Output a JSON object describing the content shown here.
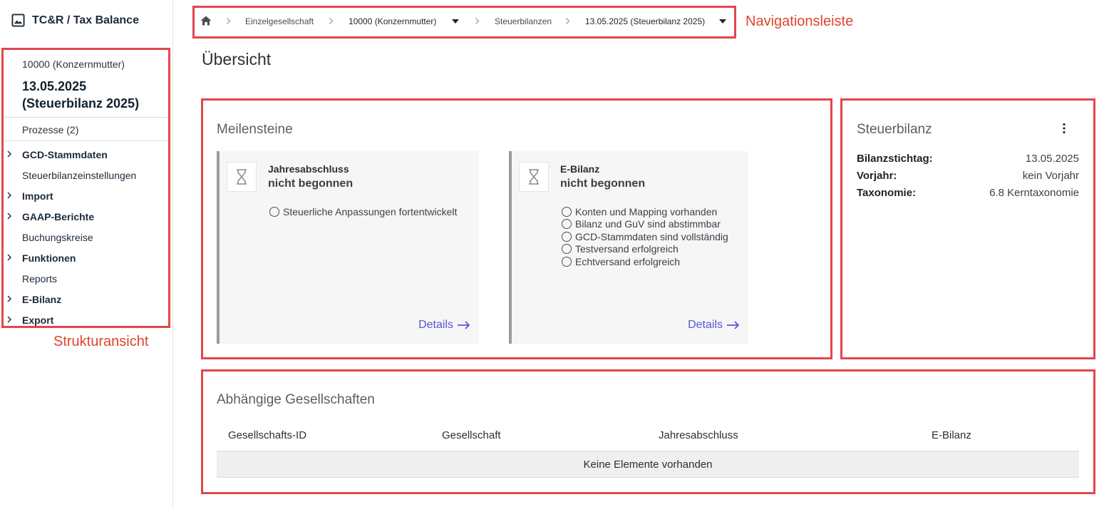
{
  "app": {
    "title": "TC&R / Tax Balance"
  },
  "sidebar": {
    "company": "10000 (Konzernmutter)",
    "date_title_line1": "13.05.2025",
    "date_title_line2": "(Steuerbilanz 2025)",
    "processes": "Prozesse (2)",
    "items": [
      {
        "label": "GCD-Stammdaten",
        "expandable": true
      },
      {
        "label": "Steuerbilanzeinstellungen",
        "expandable": false
      },
      {
        "label": "Import",
        "expandable": true
      },
      {
        "label": "GAAP-Berichte",
        "expandable": true
      },
      {
        "label": "Buchungskreise",
        "expandable": false
      },
      {
        "label": "Funktionen",
        "expandable": true
      },
      {
        "label": "Reports",
        "expandable": false
      },
      {
        "label": "E-Bilanz",
        "expandable": true
      },
      {
        "label": "Export",
        "expandable": true
      }
    ],
    "annotation": "Strukturansicht"
  },
  "breadcrumb": {
    "items": [
      "Einzelgesellschaft",
      "10000 (Konzernmutter)",
      "Steuerbilanzen",
      "13.05.2025 (Steuerbilanz 2025)"
    ],
    "annotation": "Navigationsleiste"
  },
  "page": {
    "title": "Übersicht"
  },
  "milestones": {
    "title": "Meilensteine",
    "cards": [
      {
        "name": "Jahresabschluss",
        "status": "nicht begonnen",
        "checks": [
          "Steuerliche Anpassungen fortentwickelt"
        ],
        "details": "Details"
      },
      {
        "name": "E-Bilanz",
        "status": "nicht begonnen",
        "checks": [
          "Konten und Mapping vorhanden",
          "Bilanz und GuV sind abstimmbar",
          "GCD-Stammdaten sind vollständig",
          "Testversand erfolgreich",
          "Echtversand erfolgreich"
        ],
        "details": "Details"
      }
    ]
  },
  "taxbalance": {
    "title": "Steuerbilanz",
    "rows": [
      {
        "key": "Bilanzstichtag:",
        "value": "13.05.2025"
      },
      {
        "key": "Vorjahr:",
        "value": "kein Vorjahr"
      },
      {
        "key": "Taxonomie:",
        "value": "6.8 Kerntaxonomie"
      }
    ]
  },
  "dependent": {
    "title": "Abhängige Gesellschaften",
    "columns": [
      "Gesellschafts-ID",
      "Gesellschaft",
      "Jahresabschluss",
      "E-Bilanz"
    ],
    "empty_text": "Keine Elemente vorhanden"
  },
  "colors": {
    "annotation_red": "#e4454d",
    "link": "#5a55d6"
  },
  "icons": [
    "image-icon",
    "home-icon",
    "chevron-right-icon",
    "caret-down-icon",
    "hourglass-icon",
    "arrow-right-icon",
    "kebab-menu-icon",
    "radio-circle-icon"
  ]
}
